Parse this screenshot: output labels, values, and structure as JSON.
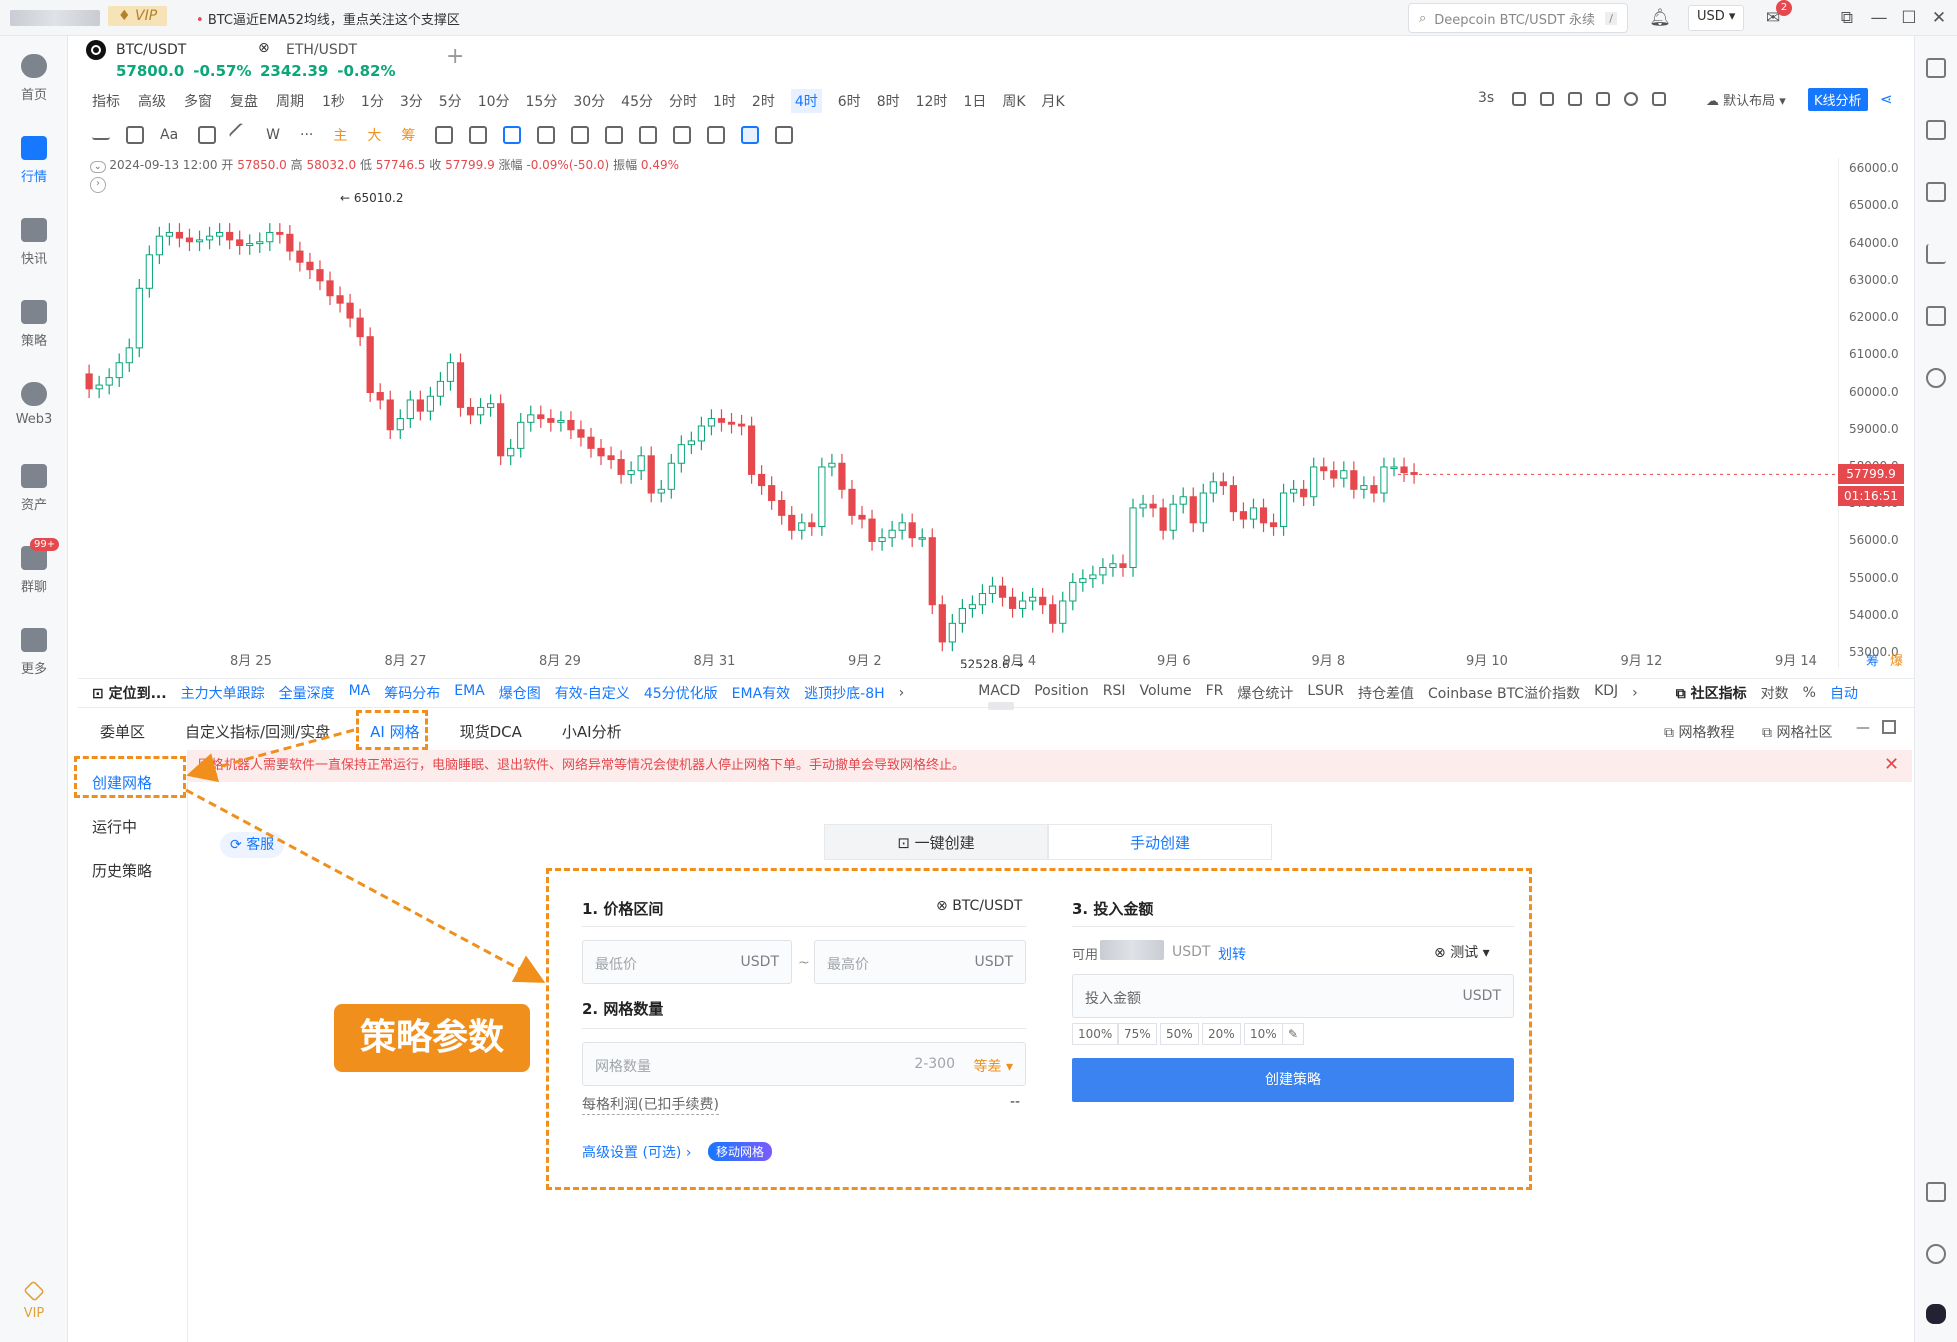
{
  "topbar": {
    "vip": "VIP",
    "news": "BTC逼近EMA52均线，重点关注这个支撑区",
    "search_placeholder": "Deepcoin BTC/USDT 永续",
    "search_shortcut": "/",
    "currency": "USD",
    "mail_badge": "2"
  },
  "leftnav": {
    "items": [
      {
        "label": "首页"
      },
      {
        "label": "行情"
      },
      {
        "label": "快讯"
      },
      {
        "label": "策略"
      },
      {
        "label": "Web3"
      },
      {
        "label": "资产"
      },
      {
        "label": "群聊"
      },
      {
        "label": "更多"
      }
    ],
    "chat_badge": "99+",
    "vip_label": "VIP"
  },
  "symbols": [
    {
      "name": "BTC/USDT",
      "price": "57800.0",
      "change": "-0.57%"
    },
    {
      "name": "ETH/USDT",
      "price": "2342.39",
      "change": "-0.82%"
    }
  ],
  "toolbar1": {
    "items": [
      "指标",
      "高级",
      "多窗",
      "复盘",
      "周期",
      "1秒",
      "1分",
      "3分",
      "5分",
      "10分",
      "15分",
      "30分",
      "45分",
      "分时",
      "1时",
      "2时",
      "4时",
      "6时",
      "8时",
      "12时",
      "1日",
      "周K",
      "月K"
    ],
    "active": "4时",
    "right_items": [
      "3s",
      "默认布局"
    ],
    "kline_button": "K线分析"
  },
  "toolbar2": {
    "text_tools": [
      "Aa",
      "W",
      "···"
    ],
    "colored": [
      "主",
      "大",
      "筹"
    ]
  },
  "ohlc": {
    "date": "2024-09-13 12:00",
    "open_label": "开",
    "open": "57850.0",
    "high_label": "高",
    "high": "58032.0",
    "low_label": "低",
    "low": "57746.5",
    "close_label": "收",
    "close": "57799.9",
    "change_label": "涨幅",
    "change": "-0.09%(-50.0)",
    "amp_label": "振幅",
    "amp": "0.49%"
  },
  "chart_data": {
    "type": "candlestick",
    "yticks": [
      "66000.0",
      "65000.0",
      "64000.0",
      "63000.0",
      "62000.0",
      "61000.0",
      "60000.0",
      "59000.0",
      "58000.0",
      "57000.0",
      "56000.0",
      "55000.0",
      "54000.0",
      "53000.0"
    ],
    "ylim": [
      52600,
      66300
    ],
    "xticks": [
      "8月 25",
      "8月 27",
      "8月 29",
      "8月 31",
      "9月 2",
      "9月 4",
      "9月 6",
      "9月 8",
      "9月 10",
      "9月 12",
      "9月 14"
    ],
    "max_label": "65010.2",
    "min_label": "52528.6",
    "last_price": "57799.9",
    "countdown": "01:16:51",
    "corner_labels": [
      "筹",
      "爆"
    ],
    "closes": [
      60100,
      60200,
      60400,
      60800,
      61200,
      62800,
      63700,
      64200,
      64300,
      64150,
      64050,
      64100,
      64200,
      64300,
      64100,
      63950,
      64000,
      64050,
      64300,
      64250,
      63800,
      63500,
      63300,
      63000,
      62600,
      62400,
      62000,
      61500,
      60000,
      59800,
      59000,
      59300,
      59800,
      59500,
      59900,
      60300,
      60800,
      59600,
      59400,
      59600,
      59700,
      58300,
      58500,
      59200,
      59400,
      59300,
      59200,
      59250,
      59000,
      58800,
      58500,
      58300,
      58200,
      57800,
      57900,
      58300,
      57300,
      57400,
      58100,
      58600,
      58700,
      59100,
      59300,
      59200,
      59150,
      59100,
      57800,
      57500,
      57100,
      56700,
      56300,
      56500,
      56400,
      58000,
      58100,
      57400,
      56700,
      56600,
      56000,
      56100,
      56300,
      56500,
      56100,
      56100,
      54300,
      53300,
      53800,
      54200,
      54300,
      54600,
      54800,
      54500,
      54200,
      54400,
      54500,
      54300,
      53800,
      54400,
      54900,
      55000,
      55100,
      55300,
      55400,
      55300,
      56900,
      57000,
      56900,
      56300,
      57000,
      57200,
      56500,
      57300,
      57600,
      57500,
      56800,
      56600,
      56900,
      56500,
      56400,
      57300,
      57400,
      57200,
      58000,
      57900,
      57700,
      57900,
      57400,
      57500,
      57300,
      58000,
      58000,
      57850,
      57800
    ]
  },
  "indicators": {
    "locate": "定位到...",
    "left": [
      "主力大单跟踪",
      "全量深度",
      "MA",
      "筹码分布",
      "EMA",
      "爆仓图",
      "有效-自定义",
      "45分优化版",
      "EMA有效",
      "逃顶抄底-8H"
    ],
    "right": [
      "MACD",
      "Position",
      "RSI",
      "Volume",
      "FR",
      "爆仓统计",
      "LSUR",
      "持仓差值",
      "Coinbase BTC溢价指数",
      "KDJ"
    ],
    "community": "社区指标",
    "log": "对数",
    "pct": "%",
    "auto": "自动"
  },
  "panel": {
    "tabs": [
      "委单区",
      "自定义指标/回测/实盘",
      "AI 网格",
      "现货DCA",
      "小AI分析"
    ],
    "active_tab": "AI 网格",
    "right_links": [
      "网格教程",
      "网格社区"
    ],
    "warning": "网格机器人需要软件一直保持正常运行，电脑睡眠、退出软件、网络异常等情况会使机器人停止网格下单。手动撤单会导致网格终止。",
    "side_menu": [
      "创建网格",
      "运行中",
      "历史策略"
    ],
    "active_side": "创建网格",
    "support": "客服"
  },
  "form": {
    "modes": [
      "一键创建",
      "手动创建"
    ],
    "active_mode": "手动创建",
    "step1": "1. 价格区间",
    "pair": "BTC/USDT",
    "min_placeholder": "最低价",
    "max_placeholder": "最高价",
    "unit": "USDT",
    "tilde": "~",
    "step2": "2. 网格数量",
    "grid_placeholder": "网格数量",
    "grid_range": "2-300",
    "grid_type": "等差",
    "profit_label": "每格利润(已扣手续费)",
    "profit_value": "--",
    "advanced": "高级设置 (可选)",
    "move_grid": "移动网格",
    "step3": "3. 投入金额",
    "available": "可用",
    "available_unit": "USDT",
    "transfer": "划转",
    "account": "测试",
    "amount_placeholder": "投入金额",
    "percents": [
      "100%",
      "75%",
      "50%",
      "20%",
      "10%"
    ],
    "create_button": "创建策略"
  },
  "annotation": {
    "callout": "策略参数",
    "color": "#f08f1c"
  }
}
